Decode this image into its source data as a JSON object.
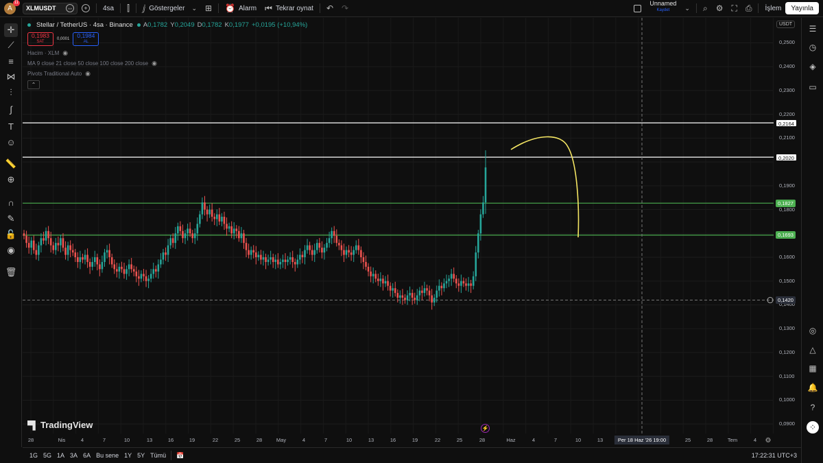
{
  "topbar": {
    "avatar_letter": "A",
    "notif_count": "11",
    "symbol": "XLMUSDT",
    "interval": "4sa",
    "indicators_label": "Göstergeler",
    "alarm_label": "Alarm",
    "replay_label": "Tekrar oynat",
    "layout_name": "Unnamed",
    "layout_status": "Kaydet",
    "trade_label": "İşlem",
    "publish_label": "Yayınla"
  },
  "legend": {
    "name": "Stellar / TetherUS · 4sa · Binance",
    "o_key": "A",
    "o_val": "0,1782",
    "h_key": "Y",
    "h_val": "0,2049",
    "l_key": "D",
    "l_val": "0,1782",
    "c_key": "K",
    "c_val": "0,1977",
    "change": "+0,0195 (+10,94%)",
    "sell_price": "0,1983",
    "sell_label": "SAT",
    "spread": "0,0001",
    "buy_price": "0,1984",
    "buy_label": "AL",
    "indicators": [
      "Hacim · XLM",
      "MA 9 close 21 close 50 close 100 close 200 close",
      "Pivots Traditional Auto"
    ]
  },
  "price_axis": {
    "currency": "USDT",
    "labels": [
      "0,2500",
      "0,2400",
      "0,2300",
      "0,2200",
      "0,2100",
      "0,1900",
      "0,1800",
      "0,1600",
      "0,1500",
      "0,1400",
      "0,1300",
      "0,1200",
      "0,1100",
      "0,1000",
      "0,0900"
    ],
    "tags": [
      {
        "text": "0,2164",
        "kind": "white"
      },
      {
        "text": "0,2020",
        "kind": "white"
      },
      {
        "text": "0,1827",
        "kind": "green"
      },
      {
        "text": "0,1693",
        "kind": "green"
      },
      {
        "text": "0,1420",
        "kind": "cursor"
      }
    ]
  },
  "time_axis": {
    "labels": [
      "28",
      "Nis",
      "4",
      "7",
      "10",
      "13",
      "16",
      "19",
      "22",
      "25",
      "28",
      "May",
      "4",
      "7",
      "10",
      "13",
      "16",
      "19",
      "22",
      "25",
      "28",
      "Haz",
      "4",
      "7",
      "10",
      "13",
      "25",
      "28",
      "Tem",
      "4"
    ],
    "cursor_label": "Per 18 Haz '26   19:00"
  },
  "bottombar": {
    "ranges": [
      "1G",
      "5G",
      "1A",
      "3A",
      "6A",
      "Bu sene",
      "1Y",
      "5Y",
      "Tümü"
    ],
    "clock": "17:22:31 UTC+3"
  },
  "brand": "TradingView",
  "colors": {
    "up": "#26a69a",
    "down": "#ef5350",
    "hline_white": "#ffffff",
    "hline_green": "#4caf50",
    "annotation": "#f5e663"
  },
  "chart_data": {
    "type": "candlestick",
    "price_range": [
      0.086,
      0.2605
    ],
    "horizontal_lines": [
      0.2164,
      0.202,
      0.1827,
      0.1693
    ],
    "crosshair_price": 0.142,
    "closes": [
      0.169,
      0.166,
      0.164,
      0.167,
      0.163,
      0.161,
      0.165,
      0.168,
      0.167,
      0.171,
      0.168,
      0.165,
      0.163,
      0.166,
      0.165,
      0.168,
      0.164,
      0.161,
      0.165,
      0.163,
      0.162,
      0.16,
      0.158,
      0.16,
      0.159,
      0.161,
      0.158,
      0.156,
      0.158,
      0.16,
      0.157,
      0.155,
      0.158,
      0.162,
      0.163,
      0.16,
      0.157,
      0.155,
      0.154,
      0.156,
      0.155,
      0.153,
      0.155,
      0.157,
      0.155,
      0.154,
      0.152,
      0.151,
      0.153,
      0.152,
      0.15,
      0.151,
      0.153,
      0.155,
      0.154,
      0.157,
      0.159,
      0.162,
      0.161,
      0.165,
      0.168,
      0.166,
      0.17,
      0.173,
      0.171,
      0.168,
      0.17,
      0.172,
      0.17,
      0.168,
      0.17,
      0.174,
      0.178,
      0.183,
      0.18,
      0.178,
      0.18,
      0.177,
      0.176,
      0.178,
      0.175,
      0.177,
      0.174,
      0.172,
      0.173,
      0.17,
      0.172,
      0.171,
      0.168,
      0.17,
      0.166,
      0.163,
      0.161,
      0.163,
      0.162,
      0.16,
      0.161,
      0.159,
      0.16,
      0.158,
      0.159,
      0.16,
      0.158,
      0.159,
      0.157,
      0.158,
      0.159,
      0.158,
      0.159,
      0.16,
      0.158,
      0.157,
      0.159,
      0.161,
      0.16,
      0.163,
      0.165,
      0.163,
      0.161,
      0.163,
      0.166,
      0.164,
      0.162,
      0.164,
      0.166,
      0.168,
      0.171,
      0.169,
      0.166,
      0.165,
      0.163,
      0.161,
      0.163,
      0.162,
      0.161,
      0.163,
      0.165,
      0.163,
      0.16,
      0.158,
      0.156,
      0.154,
      0.152,
      0.153,
      0.151,
      0.15,
      0.151,
      0.149,
      0.15,
      0.148,
      0.146,
      0.147,
      0.145,
      0.143,
      0.144,
      0.143,
      0.142,
      0.144,
      0.145,
      0.143,
      0.142,
      0.144,
      0.146,
      0.145,
      0.147,
      0.146,
      0.144,
      0.141,
      0.143,
      0.146,
      0.148,
      0.147,
      0.149,
      0.15,
      0.151,
      0.153,
      0.151,
      0.149,
      0.148,
      0.15,
      0.149,
      0.148,
      0.149,
      0.148,
      0.152,
      0.162,
      0.17,
      0.178,
      0.183,
      0.1977
    ]
  }
}
